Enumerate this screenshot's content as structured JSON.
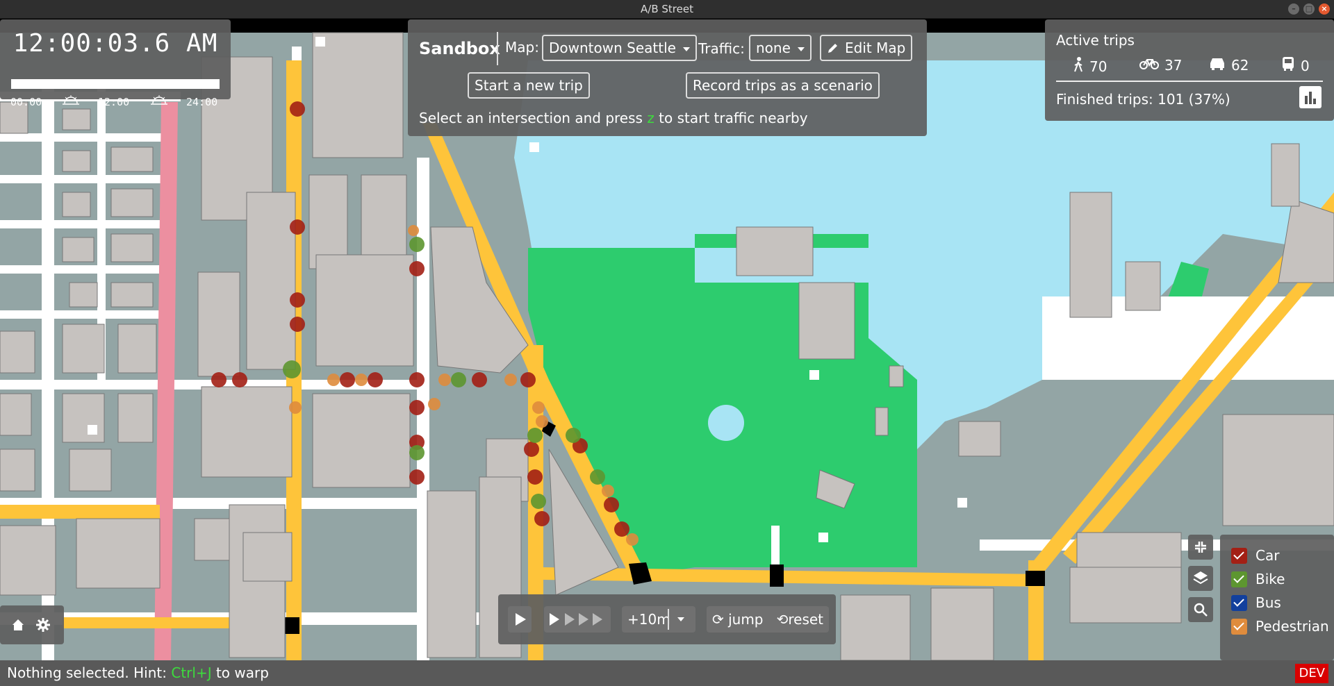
{
  "window": {
    "title": "A/B Street"
  },
  "clock": {
    "time": "12:00:03.6 AM",
    "progress": 0.0,
    "ticks": [
      "00:00",
      "12:00",
      "24:00"
    ]
  },
  "sandbox": {
    "title": "Sandbox",
    "map_label": "Map:",
    "map_value": "Downtown Seattle",
    "traffic_label": "Traffic:",
    "traffic_value": "none",
    "edit_map": "Edit Map",
    "start_trip": "Start a new trip",
    "record": "Record trips as a scenario",
    "hint_pre": "Select an intersection and press ",
    "hint_key": "z",
    "hint_post": " to start traffic nearby"
  },
  "active_trips": {
    "title": "Active trips",
    "walk": "70",
    "bike": "37",
    "car": "62",
    "bus": "0",
    "finished": "Finished trips: 101 (37%)"
  },
  "legend": {
    "items": [
      {
        "label": "Car",
        "color": "#a32015"
      },
      {
        "label": "Bike",
        "color": "#5d9630"
      },
      {
        "label": "Bus",
        "color": "#12409d"
      },
      {
        "label": "Pedestrian",
        "color": "#df8c3d"
      }
    ]
  },
  "speed": {
    "step": "+10m",
    "jump": "jump",
    "reset": "reset"
  },
  "status": {
    "pre": "Nothing selected. Hint: ",
    "key": "Ctrl+J",
    "post": " to warp",
    "dev": "DEV"
  },
  "colors": {
    "water": "#a8e4f4",
    "park": "#2dcc6e",
    "road": "#fec43a",
    "sidewalk": "#ffffff",
    "block": "#93a5a5",
    "building": "#c6c2bf",
    "rail": "#ec8fa0"
  }
}
